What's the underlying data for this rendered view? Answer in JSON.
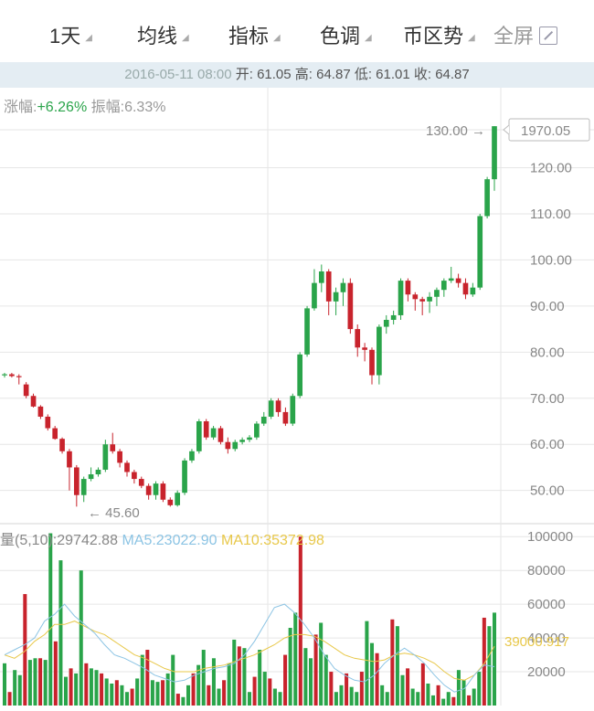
{
  "toolbar": {
    "period": "1天",
    "ma": "均线",
    "indicator": "指标",
    "color": "色调",
    "trend": "币区势",
    "fullscreen": "全屏"
  },
  "info": {
    "datetime": "2016-05-11 08:00",
    "ohlc_text": "开: 61.05 高: 64.87 低: 61.01 收: 64.87"
  },
  "change": {
    "rise_label": "涨幅:",
    "rise_value": "+6.26%",
    "amp_label": "振幅:",
    "amp_value": "6.33%"
  },
  "volume_legend": {
    "vol": "量(5,10):29742.88",
    "ma5": "MA5:23022.90",
    "ma10": "MA10:35372.98"
  },
  "markers": {
    "high": "130.00",
    "high_box": "1970.05",
    "low": "45.60",
    "vol_current": "39000.917"
  },
  "colors": {
    "up": "#2aa44a",
    "down": "#c8232c",
    "ma5": "#8cc4e4",
    "ma10": "#e8c84a",
    "grid": "#e6e6e6"
  },
  "chart_data": {
    "type": "candlestick",
    "price_axis": {
      "ticks": [
        50,
        60,
        70,
        80,
        90,
        100,
        110,
        120
      ],
      "ylim": [
        43,
        131
      ]
    },
    "volume_axis": {
      "ticks": [
        20000,
        40000,
        60000,
        80000,
        100000
      ],
      "ylim": [
        0,
        105000
      ]
    },
    "candles": [
      [
        75,
        75.5,
        74.5,
        75.2
      ],
      [
        75.2,
        75.5,
        74.5,
        74.8
      ],
      [
        74.8,
        75.2,
        73,
        74.6
      ],
      [
        73,
        73.5,
        70,
        70.5
      ],
      [
        70.5,
        71,
        68,
        68.2
      ],
      [
        68.2,
        68.5,
        65.5,
        66
      ],
      [
        66,
        66.5,
        63,
        63.5
      ],
      [
        63.5,
        64,
        61,
        61.2
      ],
      [
        61.2,
        61.5,
        58,
        58.5
      ],
      [
        58.5,
        59,
        50,
        55
      ],
      [
        55,
        55.5,
        46.5,
        49
      ],
      [
        49,
        53,
        47.5,
        52.5
      ],
      [
        52.5,
        55,
        52,
        53.5
      ],
      [
        53.5,
        55,
        53,
        54.5
      ],
      [
        54.5,
        61,
        54,
        60
      ],
      [
        60,
        62.5,
        58,
        58.5
      ],
      [
        58.5,
        59,
        55,
        56
      ],
      [
        56,
        56.5,
        53,
        54
      ],
      [
        54,
        54.5,
        51.5,
        52.5
      ],
      [
        52.5,
        53,
        50.5,
        51
      ],
      [
        51,
        51.5,
        48,
        49
      ],
      [
        49,
        52,
        48,
        51.5
      ],
      [
        51.5,
        52,
        47.5,
        48
      ],
      [
        48,
        48.5,
        46.5,
        46.8
      ],
      [
        46.8,
        50,
        46.5,
        49.5
      ],
      [
        49.5,
        57,
        49,
        56.5
      ],
      [
        56.5,
        59,
        56,
        58.5
      ],
      [
        58.5,
        65.5,
        58,
        65
      ],
      [
        65,
        65.5,
        61,
        61.5
      ],
      [
        61.5,
        64,
        61,
        63.5
      ],
      [
        63.5,
        64,
        60,
        60.5
      ],
      [
        60.5,
        61.5,
        58,
        59
      ],
      [
        59,
        61,
        58.5,
        60.5
      ],
      [
        60.5,
        61.5,
        60,
        61
      ],
      [
        61,
        62,
        60.5,
        61.5
      ],
      [
        61.5,
        65,
        61,
        64.5
      ],
      [
        64.5,
        67,
        64,
        66
      ],
      [
        66,
        70,
        65.5,
        69.5
      ],
      [
        69.5,
        70,
        66,
        67
      ],
      [
        67,
        68,
        64,
        64.5
      ],
      [
        64.5,
        71,
        64,
        70.5
      ],
      [
        70.5,
        80,
        70,
        79.5
      ],
      [
        79.5,
        90,
        79,
        89.5
      ],
      [
        89.5,
        98,
        89,
        95
      ],
      [
        95,
        99,
        93,
        97.5
      ],
      [
        97.5,
        98,
        88,
        91
      ],
      [
        91,
        94,
        88,
        93
      ],
      [
        93,
        96,
        90,
        95
      ],
      [
        95,
        96,
        84,
        85
      ],
      [
        85,
        86,
        79,
        81
      ],
      [
        81,
        82,
        78,
        80.5
      ],
      [
        80.5,
        81,
        73,
        75
      ],
      [
        75,
        86,
        73,
        85.5
      ],
      [
        85.5,
        88,
        84,
        87
      ],
      [
        87,
        89,
        86,
        88
      ],
      [
        88,
        96,
        87,
        95.5
      ],
      [
        95.5,
        96,
        91,
        92.5
      ],
      [
        92.5,
        93,
        89,
        91.5
      ],
      [
        91.5,
        92,
        88,
        91
      ],
      [
        91,
        93,
        88.5,
        92
      ],
      [
        92,
        94,
        90,
        93.5
      ],
      [
        93.5,
        96,
        92,
        95.5
      ],
      [
        95.5,
        98.5,
        95,
        96
      ],
      [
        96,
        97,
        94,
        95
      ],
      [
        95,
        96,
        91.5,
        92.5
      ],
      [
        92.5,
        95,
        92,
        94
      ],
      [
        94,
        110,
        93.5,
        109.5
      ],
      [
        109.5,
        118,
        109,
        117.5
      ],
      [
        117.5,
        129,
        115,
        129
      ]
    ],
    "volumes": [
      25000,
      8000,
      21000,
      18000,
      66000,
      27000,
      28000,
      28000,
      27000,
      102000,
      38000,
      86000,
      17000,
      22000,
      19000,
      80000,
      25000,
      22000,
      21000,
      19000,
      16000,
      13000,
      15000,
      12000,
      8000,
      10000,
      16000,
      30000,
      33000,
      15000,
      14000,
      15000,
      19000,
      30000,
      7000,
      5000,
      12000,
      19000,
      24000,
      33000,
      12000,
      28000,
      10000,
      15000,
      25000,
      39000,
      35000,
      34000,
      8000,
      17000,
      33000,
      20000,
      16000,
      10000,
      8000,
      30000,
      46000,
      55000,
      100000,
      34000,
      28000,
      42000,
      49000,
      30000,
      20000,
      8000,
      12000,
      19000,
      11000,
      8000,
      20000,
      50000,
      37000,
      31000,
      12000,
      8000,
      51000,
      47000,
      18000,
      22000,
      10000,
      8000,
      25000,
      13000,
      6000,
      12000,
      4000,
      8000,
      5000,
      21000,
      15000,
      6000,
      10000,
      20000,
      52000,
      47000,
      55000
    ],
    "ma5_line": [
      30000,
      33000,
      36000,
      40000,
      50000,
      54000,
      60000,
      53000,
      48000,
      43000,
      36000,
      30000,
      28000,
      25000,
      22000,
      18000,
      16000,
      14000,
      15000,
      18000,
      20000,
      22000,
      23000,
      25000,
      30000,
      38000,
      48000,
      58000,
      60000,
      55000,
      48000,
      40000,
      30000,
      22000,
      18000,
      15000,
      14000,
      18000,
      25000,
      30000,
      34000,
      30000,
      25000,
      18000,
      12000,
      8000,
      10000,
      18000,
      24000,
      23000
    ],
    "ma10_line": [
      30000,
      28000,
      32000,
      38000,
      42000,
      48000,
      48000,
      50000,
      47000,
      44000,
      42000,
      38000,
      34000,
      30000,
      28000,
      25000,
      22000,
      20000,
      20000,
      20000,
      22000,
      23000,
      24000,
      26000,
      28000,
      30000,
      33000,
      36000,
      40000,
      42000,
      42000,
      41000,
      38000,
      34000,
      30000,
      28000,
      27000,
      26000,
      27000,
      30000,
      31000,
      30000,
      28000,
      25000,
      20000,
      16000,
      15000,
      18000,
      25000,
      35000
    ]
  }
}
